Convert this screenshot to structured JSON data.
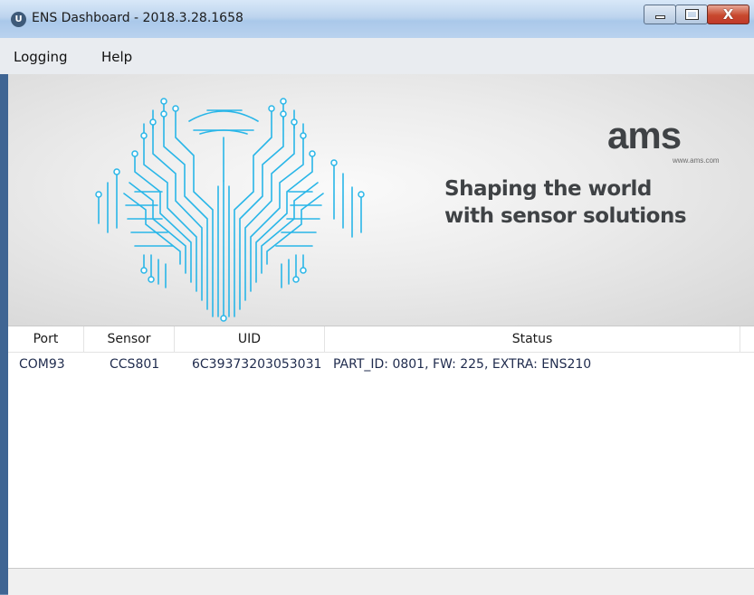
{
  "window": {
    "title": "ENS Dashboard - 2018.3.28.1658",
    "icon": "ams-app-icon",
    "icon_glyph": "U",
    "controls": {
      "minimize": "minimize-icon",
      "maximize": "maximize-icon",
      "close_glyph": "X"
    }
  },
  "menu": {
    "items": [
      {
        "label": "Logging"
      },
      {
        "label": "Help"
      }
    ]
  },
  "banner": {
    "logo_text": "ams",
    "logo_url": "www.ams.com",
    "tagline_line1": "Shaping the world",
    "tagline_line2": "with sensor solutions",
    "colors": {
      "circuit": "#29b6e8",
      "logo": "#3f4245"
    }
  },
  "table": {
    "columns": [
      "Port",
      "Sensor",
      "UID",
      "Status"
    ],
    "rows": [
      {
        "port": "COM93",
        "sensor": "CCS801",
        "uid": "6C39373203053031",
        "status": "PART_ID: 0801, FW: 225, EXTRA: ENS210"
      }
    ]
  }
}
